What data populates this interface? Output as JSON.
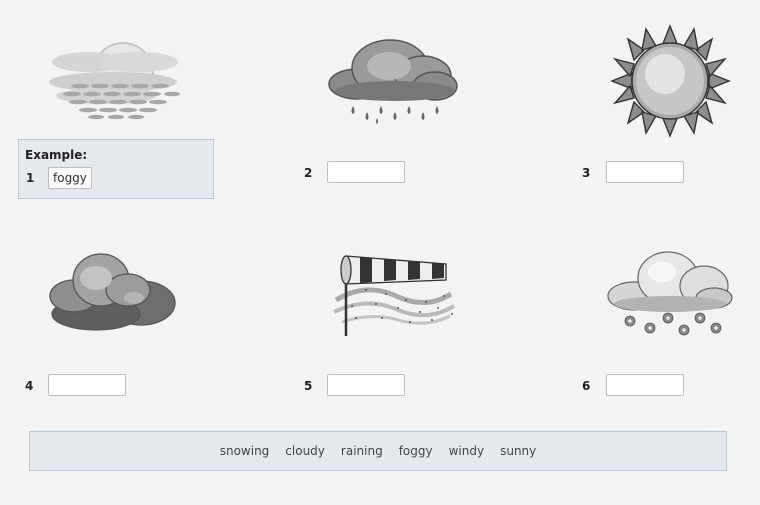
{
  "example": {
    "title": "Example:",
    "number": "1",
    "answer": "foggy"
  },
  "items": [
    {
      "number": "2",
      "icon": "rain-cloud-icon",
      "value": ""
    },
    {
      "number": "3",
      "icon": "sun-icon",
      "value": ""
    },
    {
      "number": "4",
      "icon": "cloud-icon",
      "value": ""
    },
    {
      "number": "5",
      "icon": "windsock-icon",
      "value": ""
    },
    {
      "number": "6",
      "icon": "snow-cloud-icon",
      "value": ""
    }
  ],
  "word_bank": [
    "snowing",
    "cloudy",
    "raining",
    "foggy",
    "windy",
    "sunny"
  ]
}
